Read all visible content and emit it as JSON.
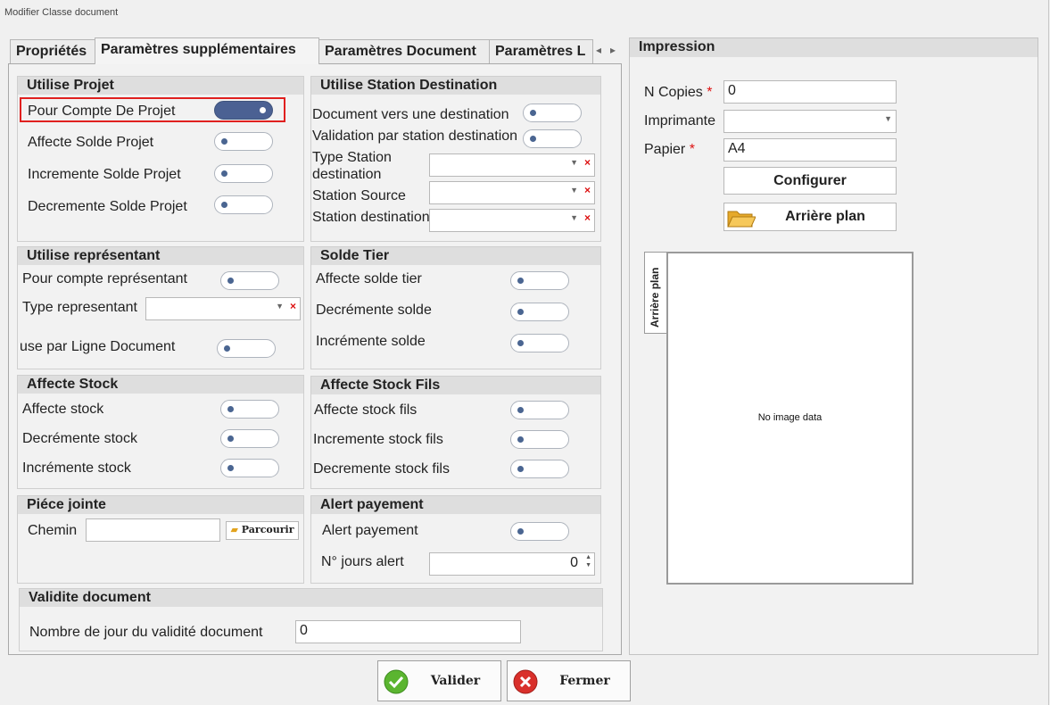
{
  "window": {
    "title": "Modifier Classe document"
  },
  "tabs": [
    {
      "label": "Propriétés"
    },
    {
      "label": "Paramètres supplémentaires"
    },
    {
      "label": "Paramètres Document"
    },
    {
      "label": "Paramètres L"
    }
  ],
  "tab_arrows": {
    "left": "◂",
    "right": "▸"
  },
  "utilise_projet": {
    "title": "Utilise Projet",
    "items": [
      {
        "label": "Pour Compte De Projet",
        "on": true
      },
      {
        "label": "Affecte Solde Projet",
        "on": false
      },
      {
        "label": "Incremente Solde Projet",
        "on": false
      },
      {
        "label": "Decremente Solde Projet",
        "on": false
      }
    ]
  },
  "utilise_station": {
    "title": "Utilise Station Destination",
    "items": [
      {
        "label": "Document vers une destination"
      },
      {
        "label": "Validation par station destination"
      }
    ],
    "combos": [
      {
        "label_l1": "Type Station",
        "label_l2": "destination",
        "value": ""
      },
      {
        "label": "Station Source",
        "value": ""
      },
      {
        "label": "Station destination",
        "value": ""
      }
    ]
  },
  "utilise_representant": {
    "title": "Utilise représentant",
    "pour_compte": "Pour compte représentant",
    "type_label": "Type representant",
    "type_value": "",
    "use_ligne": "use par Ligne Document"
  },
  "solde_tier": {
    "title": "Solde Tier",
    "items": [
      "Affecte solde tier",
      "Decrémente solde",
      "Incrémente solde"
    ]
  },
  "affecte_stock": {
    "title": "Affecte Stock",
    "items": [
      "Affecte stock",
      "Decrémente stock",
      "Incrémente stock"
    ]
  },
  "affecte_stock_fils": {
    "title": "Affecte Stock Fils",
    "items": [
      "Affecte stock fils",
      "Incremente stock fils",
      "Decremente stock fils"
    ]
  },
  "piece_jointe": {
    "title": "Piéce jointe",
    "chemin_label": "Chemin",
    "chemin_value": "",
    "browse": "Parcourir"
  },
  "alert_payement": {
    "title": "Alert payement",
    "toggle_label": "Alert payement",
    "jours_label": "N° jours alert",
    "jours_value": "0"
  },
  "validite": {
    "title": "Validite document",
    "label": "Nombre de jour du validité document",
    "value": "0"
  },
  "impression": {
    "title": "Impression",
    "copies_label": "N Copies",
    "copies_value": "0",
    "imprimante_label": "Imprimante",
    "imprimante_value": "",
    "papier_label": "Papier",
    "papier_value": "A4",
    "required_mark": "*",
    "configurer": "Configurer",
    "arriere_plan": "Arrière plan",
    "vertical_tab": "Arrière plan",
    "no_image": "No image data"
  },
  "buttons": {
    "valider": "Valider",
    "fermer": "Fermer"
  },
  "colors": {
    "accent": "#4b6193",
    "highlight": "#e0201f",
    "required": "#dd1111",
    "ok": "#5bb530",
    "cancel": "#d9302b"
  }
}
